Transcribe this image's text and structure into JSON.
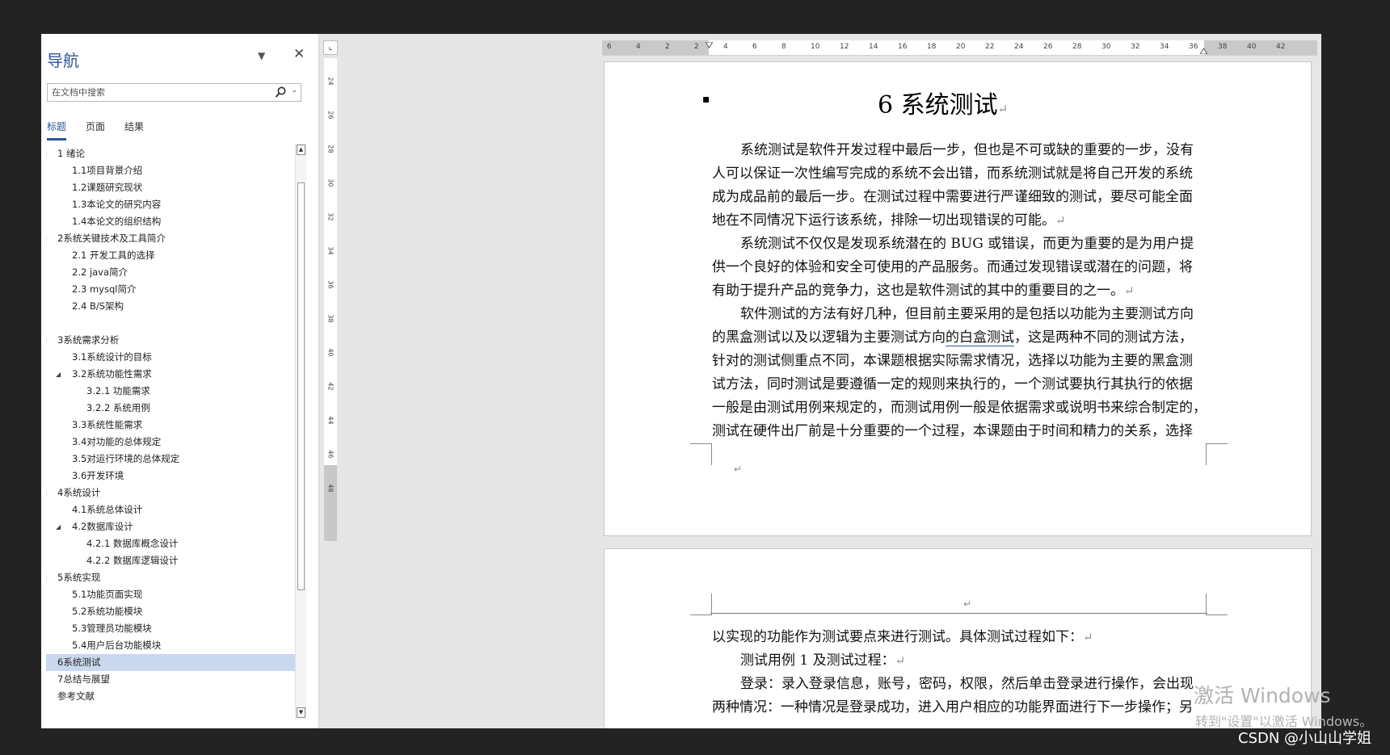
{
  "nav": {
    "title": "导航",
    "dropdown_glyph": "▼",
    "close_glyph": "✕",
    "search": {
      "placeholder": "在文档中搜索",
      "chevron": "⌄"
    },
    "tabs": [
      {
        "label": "标题"
      },
      {
        "label": "页面"
      },
      {
        "label": "结果"
      }
    ],
    "headings": [
      {
        "level": 1,
        "text": "1 绪论",
        "expanded": true
      },
      {
        "level": 2,
        "text": "1.1项目背景介绍"
      },
      {
        "level": 2,
        "text": "1.2课题研究现状"
      },
      {
        "level": 2,
        "text": "1.3本论文的研究内容"
      },
      {
        "level": 2,
        "text": "1.4本论文的组织结构"
      },
      {
        "level": 1,
        "text": "2系统关键技术及工具简介",
        "expanded": true
      },
      {
        "level": 2,
        "text": "2.1 开发工具的选择"
      },
      {
        "level": 2,
        "text": "2.2 java简介"
      },
      {
        "level": 2,
        "text": "2.3 mysql简介"
      },
      {
        "level": 2,
        "text": "2.4 B/S架构"
      },
      {
        "level": 0,
        "text": ""
      },
      {
        "level": 1,
        "text": "3系统需求分析",
        "expanded": true
      },
      {
        "level": 2,
        "text": "3.1系统设计的目标"
      },
      {
        "level": 2,
        "text": "3.2系统功能性需求",
        "expanded": true
      },
      {
        "level": 3,
        "text": "3.2.1 功能需求"
      },
      {
        "level": 3,
        "text": "3.2.2 系统用例"
      },
      {
        "level": 2,
        "text": "3.3系统性能需求"
      },
      {
        "level": 2,
        "text": "3.4对功能的总体规定"
      },
      {
        "level": 2,
        "text": "3.5对运行环境的总体规定"
      },
      {
        "level": 2,
        "text": "3.6开发环境"
      },
      {
        "level": 1,
        "text": "4系统设计",
        "expanded": true
      },
      {
        "level": 2,
        "text": "4.1系统总体设计"
      },
      {
        "level": 2,
        "text": "4.2数据库设计",
        "expanded": true
      },
      {
        "level": 3,
        "text": "4.2.1 数据库概念设计"
      },
      {
        "level": 3,
        "text": "4.2.2 数据库逻辑设计"
      },
      {
        "level": 1,
        "text": "5系统实现",
        "expanded": true
      },
      {
        "level": 2,
        "text": "5.1功能页面实现"
      },
      {
        "level": 2,
        "text": "5.2系统功能模块"
      },
      {
        "level": 2,
        "text": "5.3管理员功能模块"
      },
      {
        "level": 2,
        "text": "5.4用户后台功能模块"
      },
      {
        "level": 1,
        "text": "6系统测试",
        "selected": true
      },
      {
        "level": 1,
        "text": "7总结与展望"
      },
      {
        "level": 1,
        "text": "参考文献"
      }
    ]
  },
  "ruler": {
    "corner_glyph": "⌞",
    "h_ticks": [
      "6",
      "4",
      "2",
      "2",
      "4",
      "6",
      "8",
      "10",
      "12",
      "14",
      "16",
      "18",
      "20",
      "22",
      "24",
      "26",
      "28",
      "30",
      "32",
      "34",
      "36",
      "38",
      "40",
      "42"
    ],
    "v_ticks": [
      "24",
      "26",
      "28",
      "30",
      "32",
      "34",
      "36",
      "38",
      "40",
      "42",
      "44",
      "46",
      "48"
    ]
  },
  "doc": {
    "title": "6 系统测试",
    "return_mark": "↵",
    "bullet_mark": "▪",
    "page1_lines": [
      {
        "indent": true,
        "text": "系统测试是软件开发过程中最后一步，但也是不可或缺的重要的一步，没有"
      },
      {
        "indent": false,
        "text": "人可以保证一次性编写完成的系统不会出错，而系统测试就是将自己开发的系统"
      },
      {
        "indent": false,
        "text": "成为成品前的最后一步。在测试过程中需要进行严谨细致的测试，要尽可能全面"
      },
      {
        "indent": false,
        "text": "地在不同情况下运行该系统，排除一切出现错误的可能。",
        "ret": true
      },
      {
        "indent": true,
        "text": "系统测试不仅仅是发现系统潜在的 BUG 或错误，而更为重要的是为用户提"
      },
      {
        "indent": false,
        "text": "供一个良好的体验和安全可使用的产品服务。而通过发现错误或潜在的问题，将"
      },
      {
        "indent": false,
        "text": "有助于提升产品的竞争力，这也是软件测试的其中的重要目的之一。",
        "ret": true
      },
      {
        "indent": true,
        "text": "软件测试的方法有好几种，但目前主要采用的是包括以功能为主要测试方向"
      },
      {
        "indent": false,
        "text": "的黑盒测试以及以逻辑为主要测试方向",
        "link": "的白盒测试",
        "tail": "，这是两种不同的测试方法，"
      },
      {
        "indent": false,
        "text": "针对的测试侧重点不同，本课题根据实际需求情况，选择以功能为主要的黑盒测"
      },
      {
        "indent": false,
        "text": "试方法，同时测试是要遵循一定的规则来执行的，一个测试要执行其执行的依据"
      },
      {
        "indent": false,
        "text": "一般是由测试用例来规定的，而测试用例一般是依据需求或说明书来综合制定的，"
      },
      {
        "indent": false,
        "text": "测试在硬件出厂前是十分重要的一个过程，本课题由于时间和精力的关系，选择"
      }
    ],
    "page2_lines": [
      {
        "indent": false,
        "text": "以实现的功能作为测试要点来进行测试。具体测试过程如下：",
        "ret": true
      },
      {
        "indent": true,
        "text": "测试用例 1 及测试过程：",
        "ret": true
      },
      {
        "indent": true,
        "text": "登录：录入登录信息，账号，密码，权限，然后单击登录进行操作，会出现"
      },
      {
        "indent": false,
        "text": "两种情况：一种情况是登录成功，进入用户相应的功能界面进行下一步操作；另"
      }
    ]
  },
  "watermark": {
    "line1": "激活 Windows",
    "line2": "转到\"设置\"以激活 Windows。"
  },
  "badge": "CSDN @小山山学姐"
}
